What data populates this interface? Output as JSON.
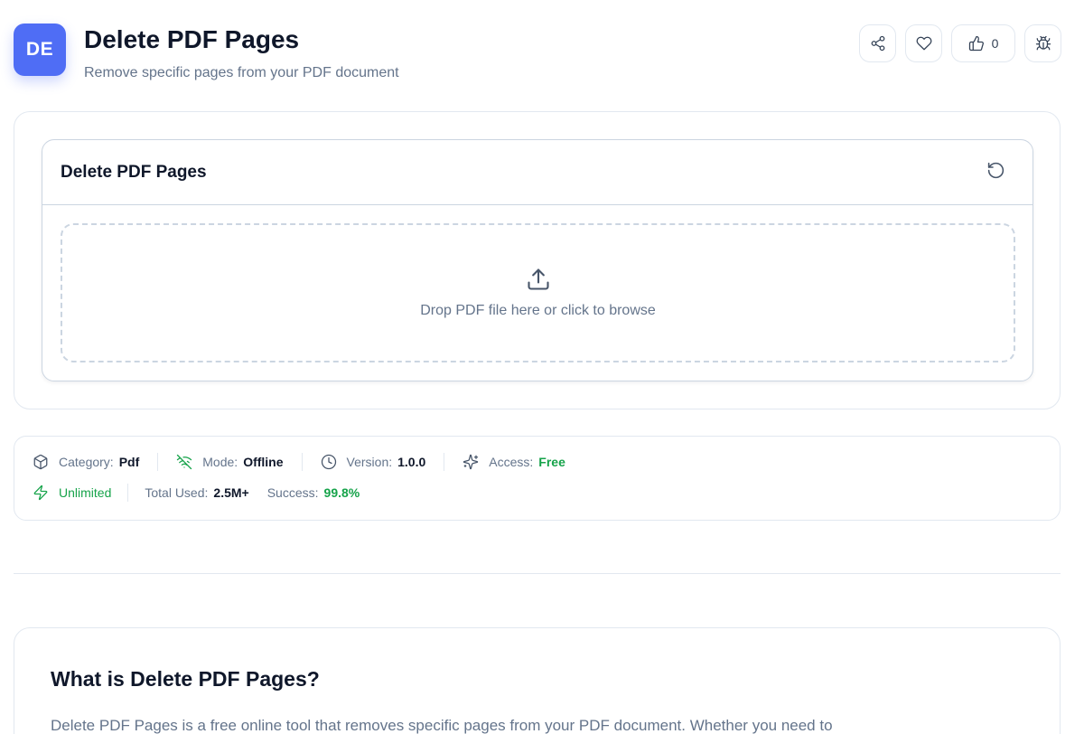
{
  "header": {
    "logo_text": "DE",
    "title": "Delete PDF Pages",
    "subtitle": "Remove specific pages from your PDF document",
    "like_count": "0"
  },
  "tool": {
    "title": "Delete PDF Pages",
    "drop_text": "Drop PDF file here or click to browse"
  },
  "meta": {
    "category_label": "Category:",
    "category_value": "Pdf",
    "mode_label": "Mode:",
    "mode_value": "Offline",
    "version_label": "Version:",
    "version_value": "1.0.0",
    "access_label": "Access:",
    "access_value": "Free",
    "unlimited_label": "Unlimited",
    "total_used_label": "Total Used:",
    "total_used_value": "2.5M+",
    "success_label": "Success:",
    "success_value": "99.8%"
  },
  "info": {
    "title": "What is Delete PDF Pages?",
    "body": "Delete PDF Pages is a free online tool that removes specific pages from your PDF document. Whether you need to"
  },
  "icons": {
    "share": "share-icon",
    "favorite": "heart-icon",
    "like": "thumbs-up-icon",
    "report": "bug-icon",
    "reset": "reset-icon",
    "upload": "upload-icon",
    "category": "box-icon",
    "mode": "wifi-off-icon",
    "version": "clock-icon",
    "access": "sparkles-icon",
    "unlimited": "zap-icon"
  },
  "colors": {
    "brand": "#4f6df5",
    "success": "#16a34a",
    "muted": "#64748b",
    "border": "#e2e8f0"
  }
}
